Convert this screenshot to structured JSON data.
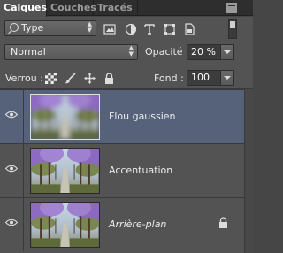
{
  "tabs": [
    {
      "label": "Calques",
      "active": true
    },
    {
      "label": "Couches",
      "active": false
    },
    {
      "label": "Tracés",
      "active": false
    }
  ],
  "filter": {
    "kind_label": "Type",
    "icons": [
      "image-filter-icon",
      "adjustment-filter-icon",
      "text-filter-icon",
      "shape-filter-icon",
      "smart-object-filter-icon"
    ]
  },
  "blend": {
    "mode": "Normal"
  },
  "opacity": {
    "label": "Opacité :",
    "value": "20 %"
  },
  "lock": {
    "label": "Verrou :",
    "icons": [
      "lock-transparency-icon",
      "lock-image-icon",
      "lock-position-icon",
      "lock-all-icon"
    ]
  },
  "fill": {
    "label": "Fond :",
    "value": "100 %"
  },
  "layers": [
    {
      "name": "Flou gaussien",
      "selected": true,
      "visible": true,
      "locked": false,
      "italic": false
    },
    {
      "name": "Accentuation",
      "selected": false,
      "visible": true,
      "locked": false,
      "italic": false
    },
    {
      "name": "Arrière-plan",
      "selected": false,
      "visible": true,
      "locked": true,
      "italic": true
    }
  ],
  "colors": {
    "accent_selected": "#56627a",
    "panel": "#535353"
  }
}
